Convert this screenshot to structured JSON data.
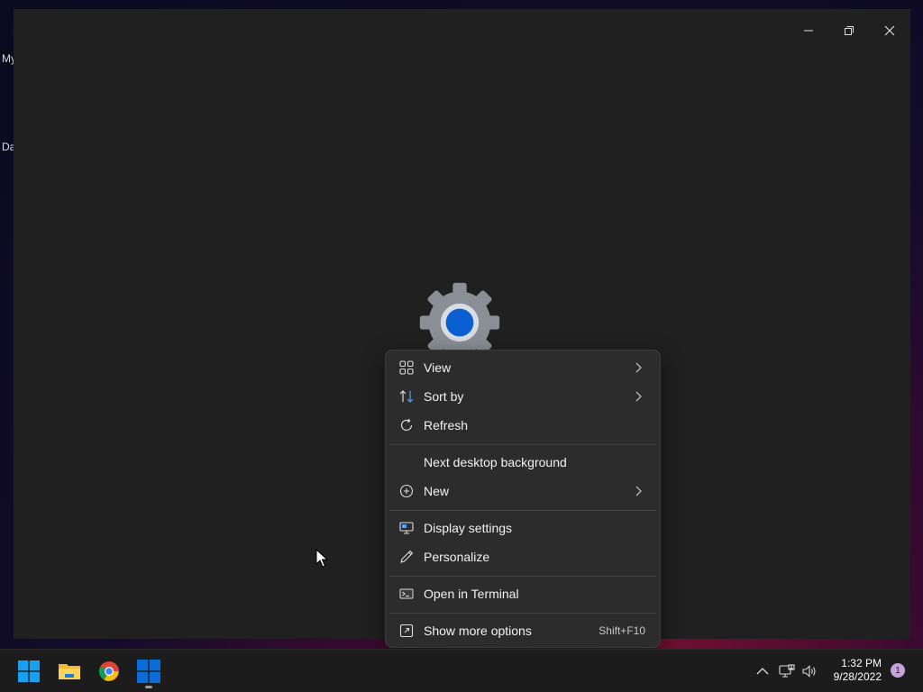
{
  "desktop": {
    "icon_labels": [
      "My",
      "Da"
    ]
  },
  "window": {
    "controls": {
      "minimize_icon": "minimize-icon",
      "restore_icon": "restore-icon",
      "close_icon": "close-icon"
    },
    "splash_icon": "settings-gear-icon"
  },
  "context_menu": {
    "items": [
      {
        "label": "View",
        "icon": "grid-view-icon",
        "submenu": true
      },
      {
        "label": "Sort by",
        "icon": "sort-icon",
        "submenu": true
      },
      {
        "label": "Refresh",
        "icon": "refresh-icon",
        "submenu": false
      },
      {
        "label": "Next desktop background",
        "icon": "",
        "submenu": false
      },
      {
        "label": "New",
        "icon": "new-plus-icon",
        "submenu": true
      },
      {
        "label": "Display settings",
        "icon": "display-icon",
        "submenu": false
      },
      {
        "label": "Personalize",
        "icon": "pen-icon",
        "submenu": false
      },
      {
        "label": "Open in Terminal",
        "icon": "terminal-icon",
        "submenu": false
      },
      {
        "label": "Show more options",
        "icon": "more-options-icon",
        "submenu": false,
        "shortcut": "Shift+F10"
      }
    ]
  },
  "taskbar": {
    "apps": [
      {
        "name": "Start",
        "icon": "windows-start-icon"
      },
      {
        "name": "File Explorer",
        "icon": "folder-icon"
      },
      {
        "name": "Google Chrome",
        "icon": "chrome-icon"
      },
      {
        "name": "Active app",
        "icon": "windows-app-icon"
      }
    ],
    "tray": {
      "icons": [
        "chevron-up-icon",
        "network-icon",
        "volume-icon"
      ],
      "time": "1:32 PM",
      "date": "9/28/2022",
      "notification_count": "1"
    }
  },
  "colors": {
    "window_bg": "#202020",
    "menu_bg": "#2c2c2c",
    "taskbar_bg": "#1c1c1c",
    "accent_blue": "#0a5fd1"
  }
}
